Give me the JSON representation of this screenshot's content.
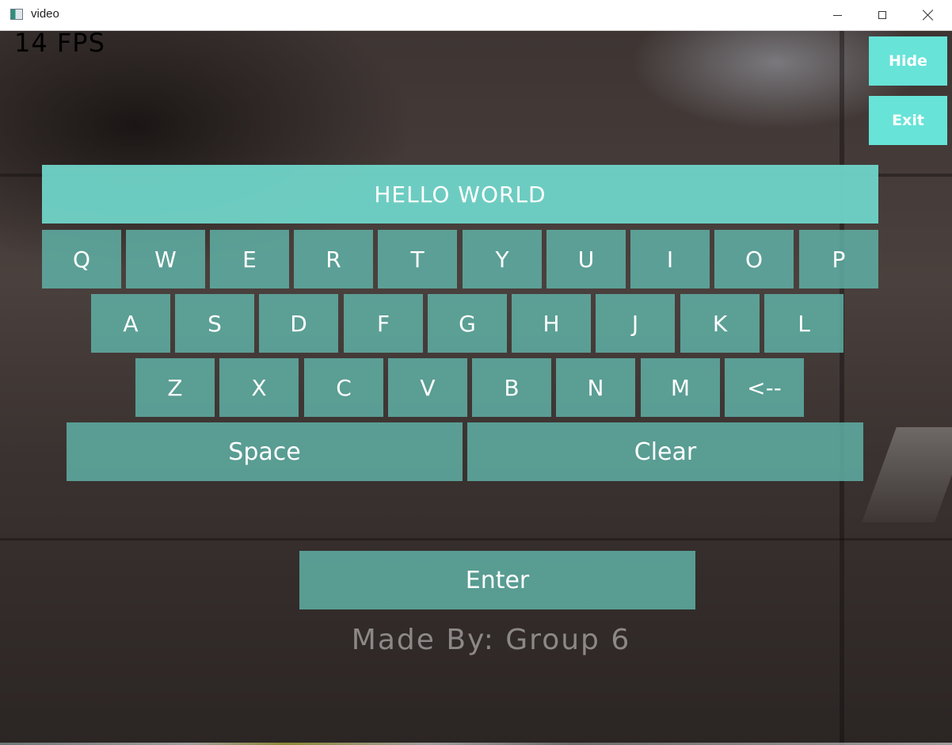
{
  "window": {
    "title": "video"
  },
  "overlay": {
    "fps": "14 FPS",
    "hide_label": "Hide",
    "exit_label": "Exit",
    "typed_text": "HELLO WORLD",
    "keyboard": {
      "row1": [
        "Q",
        "W",
        "E",
        "R",
        "T",
        "Y",
        "U",
        "I",
        "O",
        "P"
      ],
      "row2": [
        "A",
        "S",
        "D",
        "F",
        "G",
        "H",
        "J",
        "K",
        "L"
      ],
      "row3": [
        "Z",
        "X",
        "C",
        "V",
        "B",
        "N",
        "M",
        "<--"
      ],
      "space_label": "Space",
      "clear_label": "Clear"
    },
    "enter_label": "Enter",
    "credit": "Made By: Group 6"
  },
  "colors": {
    "key_fill": "#60b4aa",
    "output_fill": "#70d4c8",
    "side_button_fill": "#67e3d8",
    "key_text": "#ffffff"
  }
}
